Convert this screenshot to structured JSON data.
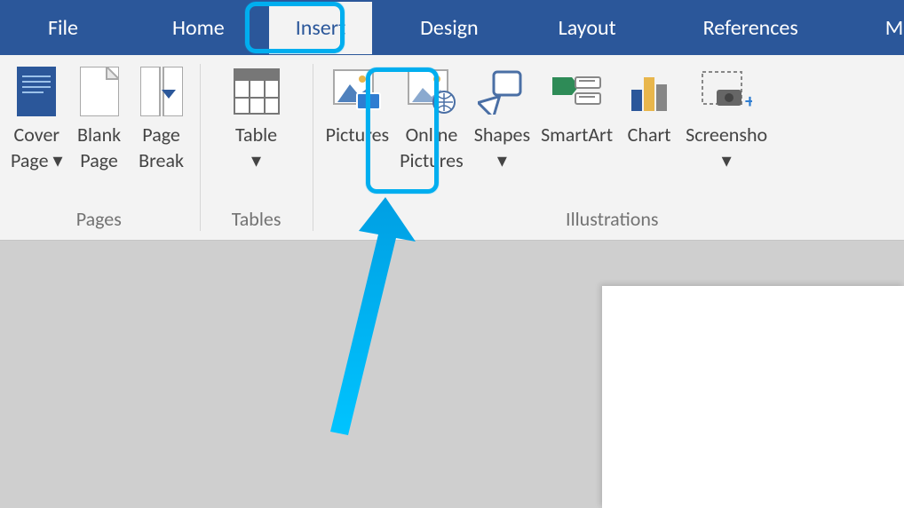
{
  "tabs": {
    "file": "File",
    "home": "Home",
    "insert": "Insert",
    "design": "Design",
    "layout": "Layout",
    "references": "References",
    "mailings": "Mailings",
    "active": "insert"
  },
  "ribbon": {
    "groups": {
      "pages": {
        "label": "Pages",
        "coverPage": "Cover\nPage ▾",
        "blankPage": "Blank\nPage",
        "pageBreak": "Page\nBreak"
      },
      "tables": {
        "label": "Tables",
        "table": "Table\n▾"
      },
      "illustrations": {
        "label": "Illustrations",
        "pictures": "Pictures",
        "onlinePictures": "Online\nPictures",
        "shapes": "Shapes\n▾",
        "smartArt": "SmartArt",
        "chart": "Chart",
        "screenshot": "Screensho\n▾"
      }
    }
  }
}
